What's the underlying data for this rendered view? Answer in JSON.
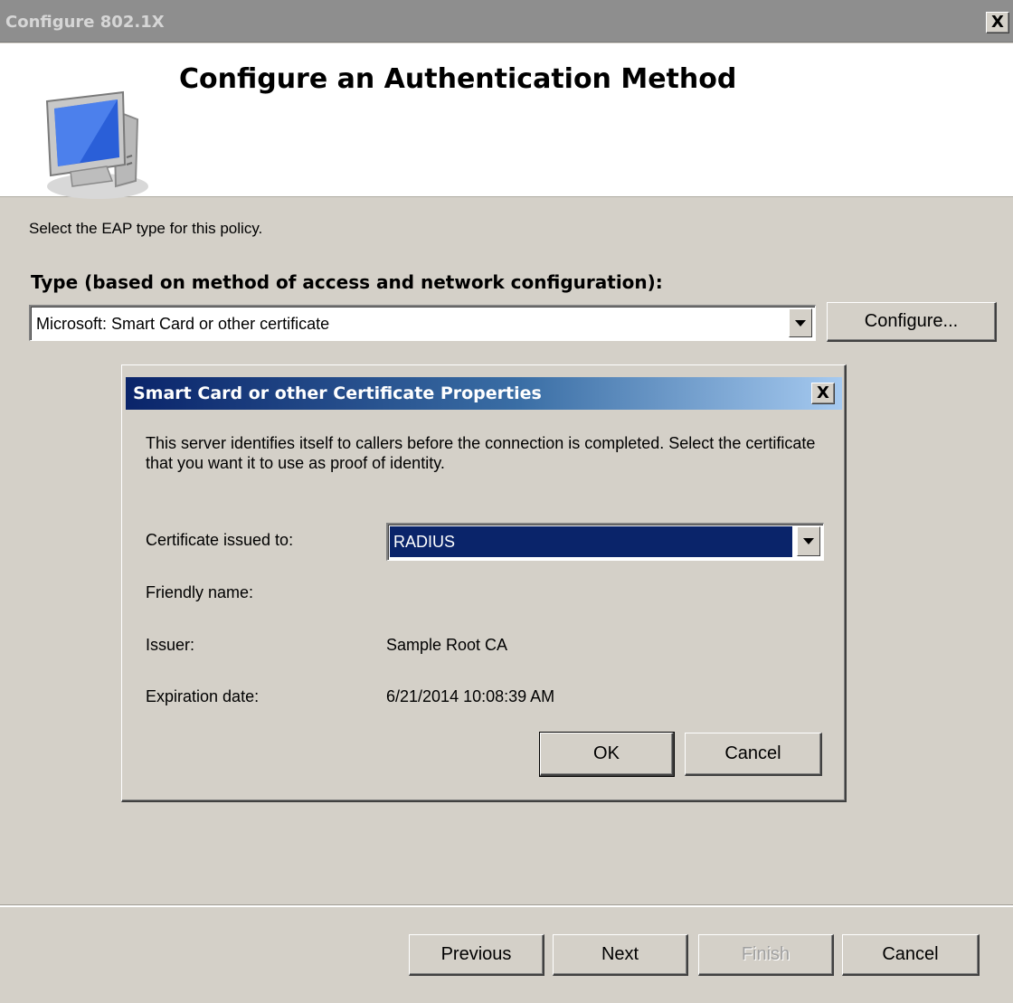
{
  "window": {
    "title": "Configure 802.1X",
    "close_glyph": "X",
    "heading": "Configure an Authentication Method",
    "icon": "monitor-icon"
  },
  "main": {
    "intro": "Select the EAP type for this policy.",
    "type_label": "Type (based on method of access and network configuration):",
    "type_value": "Microsoft: Smart Card or other certificate",
    "configure_label": "Configure..."
  },
  "dialog": {
    "title": "Smart Card or other Certificate Properties",
    "close_glyph": "X",
    "description": "This server identifies itself to callers before the connection is completed. Select the certificate that you want it to use as proof of identity.",
    "fields": {
      "cert_label": "Certificate issued to:",
      "cert_value": "RADIUS",
      "friendly_label": "Friendly name:",
      "friendly_value": "",
      "issuer_label": "Issuer:",
      "issuer_value": "Sample Root CA",
      "expiration_label": "Expiration date:",
      "expiration_value": "6/21/2014 10:08:39 AM"
    },
    "ok_label": "OK",
    "cancel_label": "Cancel"
  },
  "footer": {
    "previous": "Previous",
    "next": "Next",
    "finish": "Finish",
    "cancel": "Cancel"
  },
  "colors": {
    "face": "#d4d0c8",
    "selection": "#0a246a",
    "title_gradient_start": "#0a246a",
    "title_gradient_end": "#a6caf0"
  }
}
